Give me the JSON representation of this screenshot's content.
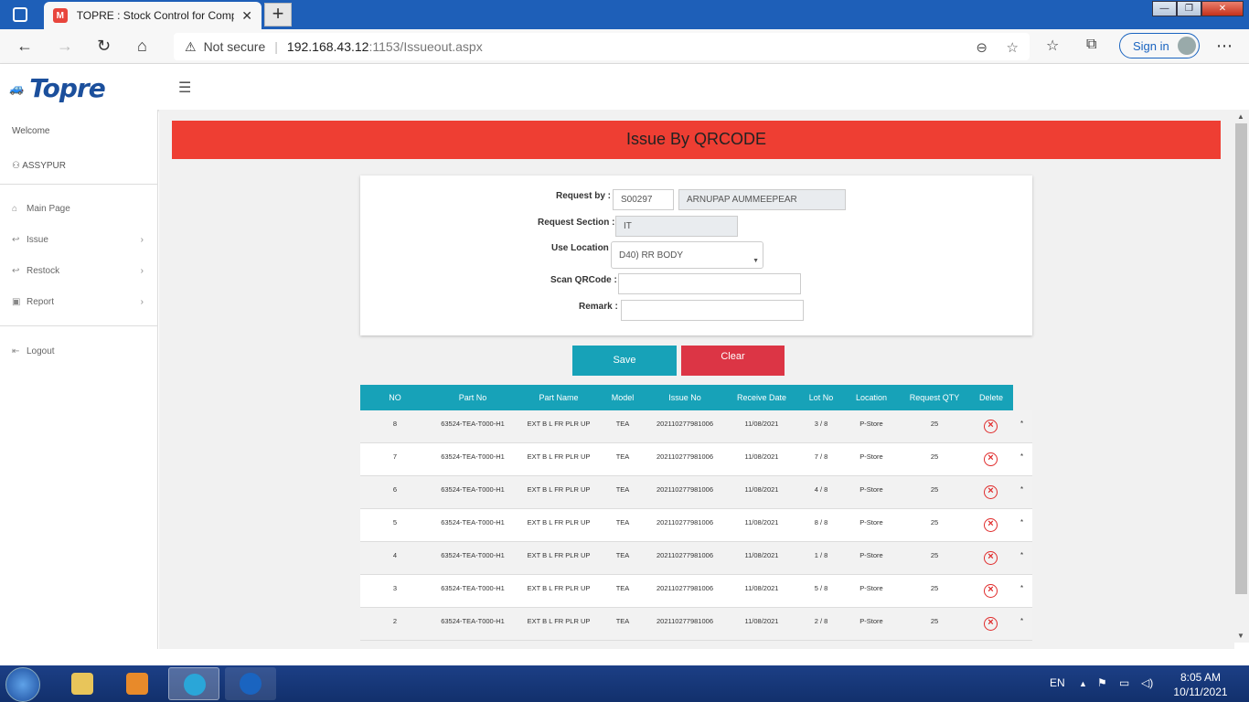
{
  "browser": {
    "tab_title": "TOPRE : Stock Control for Compo",
    "tab_favicon": "M",
    "url_warning": "Not secure",
    "url_host": "192.168.43.12",
    "url_port_path": ":1153/Issueout.aspx",
    "signin_label": "Sign in"
  },
  "app": {
    "logo_text": "Topre"
  },
  "sidebar": {
    "welcome": "Welcome",
    "user": "ASSYPUR",
    "items": [
      {
        "label": "Main Page",
        "icon": "home-icon"
      },
      {
        "label": "Issue",
        "icon": "arrow-left-icon"
      },
      {
        "label": "Restock",
        "icon": "arrow-left-icon"
      },
      {
        "label": "Report",
        "icon": "report-icon"
      },
      {
        "label": "Logout",
        "icon": "logout-icon"
      }
    ]
  },
  "page": {
    "title": "Issue By QRCODE",
    "form": {
      "request_by_label": "Request by :",
      "request_by_code": "S00297",
      "request_by_name": "ARNUPAP  AUMMEEPEAR",
      "request_section_label": "Request Section :",
      "request_section_value": "IT",
      "use_location_label": "Use Location :",
      "use_location_value": "D40) RR BODY",
      "scan_label": "Scan QRCode :",
      "scan_value": "",
      "remark_label": "Remark :",
      "remark_value": ""
    },
    "buttons": {
      "save": "Save",
      "clear": "Clear"
    },
    "table": {
      "headers": [
        "NO",
        "Part No",
        "Part Name",
        "Model",
        "Issue No",
        "Receive Date",
        "Lot No",
        "Location",
        "Request QTY",
        "Delete"
      ],
      "rows": [
        {
          "no": "8",
          "part_no": "63524-TEA-T000-H1",
          "part_name": "EXT B L FR PLR UP",
          "model": "TEA",
          "issue_no": "202110277981006",
          "receive_date": "11/08/2021",
          "lot_no": "3 / 8",
          "location": "P-Store",
          "qty": "25",
          "star": "*"
        },
        {
          "no": "7",
          "part_no": "63524-TEA-T000-H1",
          "part_name": "EXT B L FR PLR UP",
          "model": "TEA",
          "issue_no": "202110277981006",
          "receive_date": "11/08/2021",
          "lot_no": "7 / 8",
          "location": "P-Store",
          "qty": "25",
          "star": "*"
        },
        {
          "no": "6",
          "part_no": "63524-TEA-T000-H1",
          "part_name": "EXT B L FR PLR UP",
          "model": "TEA",
          "issue_no": "202110277981006",
          "receive_date": "11/08/2021",
          "lot_no": "4 / 8",
          "location": "P-Store",
          "qty": "25",
          "star": "*"
        },
        {
          "no": "5",
          "part_no": "63524-TEA-T000-H1",
          "part_name": "EXT B L FR PLR UP",
          "model": "TEA",
          "issue_no": "202110277981006",
          "receive_date": "11/08/2021",
          "lot_no": "8 / 8",
          "location": "P-Store",
          "qty": "25",
          "star": "*"
        },
        {
          "no": "4",
          "part_no": "63524-TEA-T000-H1",
          "part_name": "EXT B L FR PLR UP",
          "model": "TEA",
          "issue_no": "202110277981006",
          "receive_date": "11/08/2021",
          "lot_no": "1 / 8",
          "location": "P-Store",
          "qty": "25",
          "star": "*"
        },
        {
          "no": "3",
          "part_no": "63524-TEA-T000-H1",
          "part_name": "EXT B L FR PLR UP",
          "model": "TEA",
          "issue_no": "202110277981006",
          "receive_date": "11/08/2021",
          "lot_no": "5 / 8",
          "location": "P-Store",
          "qty": "25",
          "star": "*"
        },
        {
          "no": "2",
          "part_no": "63524-TEA-T000-H1",
          "part_name": "EXT B L FR PLR UP",
          "model": "TEA",
          "issue_no": "202110277981006",
          "receive_date": "11/08/2021",
          "lot_no": "2 / 8",
          "location": "P-Store",
          "qty": "25",
          "star": "*"
        }
      ]
    }
  },
  "taskbar": {
    "language": "EN",
    "time": "8:05 AM",
    "date": "10/11/2021"
  },
  "colors": {
    "title_red": "#ee3e33",
    "accent_teal": "#17a2b8",
    "danger": "#dc3545",
    "brand_blue": "#1b4f9c"
  }
}
